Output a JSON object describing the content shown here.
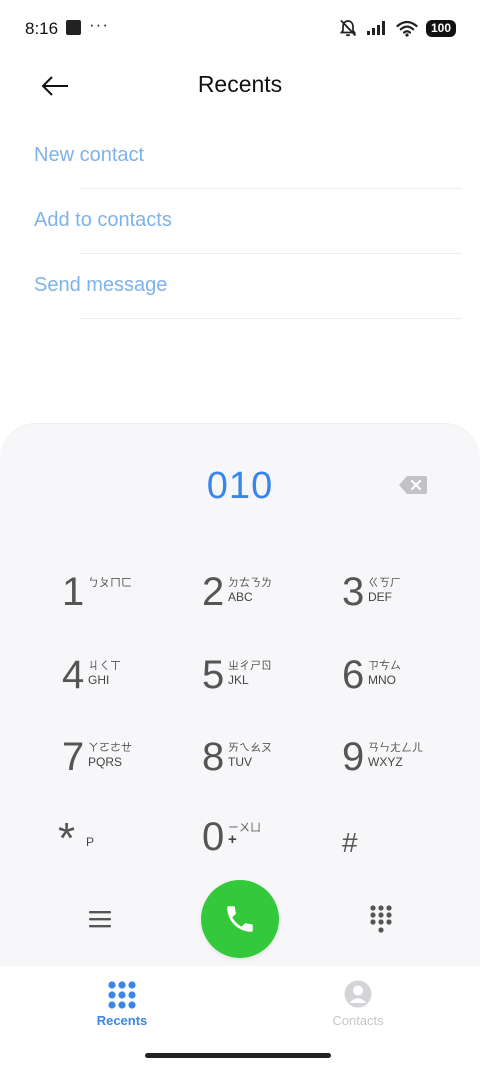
{
  "status_bar": {
    "time": "8:16",
    "dots": "···",
    "battery": "100"
  },
  "header": {
    "title": "Recents"
  },
  "actions": [
    {
      "label": "New contact"
    },
    {
      "label": "Add to contacts"
    },
    {
      "label": "Send message"
    }
  ],
  "dialer": {
    "number": "010",
    "keys": [
      {
        "digit": "1",
        "bpmf": "ㄅㄆㄇㄈ",
        "letters": ""
      },
      {
        "digit": "2",
        "bpmf": "ㄉㄊㄋㄌ",
        "letters": "ABC"
      },
      {
        "digit": "3",
        "bpmf": "ㄍㄎㄏ",
        "letters": "DEF"
      },
      {
        "digit": "4",
        "bpmf": "ㄐㄑㄒ",
        "letters": "GHI"
      },
      {
        "digit": "5",
        "bpmf": "ㄓㄔㄕㄖ",
        "letters": "JKL"
      },
      {
        "digit": "6",
        "bpmf": "ㄗㄘㄙ",
        "letters": "MNO"
      },
      {
        "digit": "7",
        "bpmf": "ㄚㄛㄜㄝ",
        "letters": "PQRS"
      },
      {
        "digit": "8",
        "bpmf": "ㄞㄟㄠㄡ",
        "letters": "TUV"
      },
      {
        "digit": "9",
        "bpmf": "ㄢㄣㄤㄥㄦ",
        "letters": "WXYZ"
      },
      {
        "digit": "*",
        "bpmf": "",
        "letters": "P"
      },
      {
        "digit": "0",
        "bpmf": "ㄧㄨㄩ",
        "letters": "+"
      },
      {
        "digit": "#",
        "bpmf": "",
        "letters": ""
      }
    ]
  },
  "tabs": [
    {
      "label": "Recents",
      "active": true
    },
    {
      "label": "Contacts",
      "active": false
    }
  ],
  "colors": {
    "accent": "#3a86e8",
    "link": "#7fb2ea",
    "call": "#33c93a",
    "inactive": "#c8c8cc"
  },
  "icons": {
    "back": "arrow-left-icon",
    "backspace": "backspace-icon",
    "menu": "menu-icon",
    "call": "phone-icon",
    "keypad": "keypad-icon",
    "recents": "grid-icon",
    "contacts": "person-icon"
  }
}
